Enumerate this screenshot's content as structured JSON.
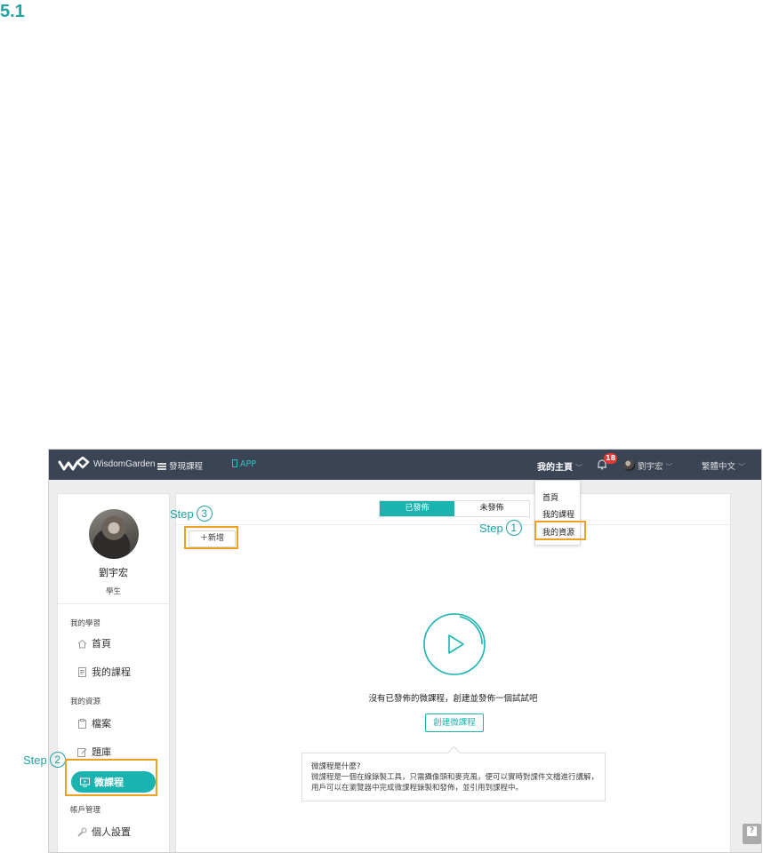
{
  "heading": "5.1",
  "topbar": {
    "brand": "WisdomGarden",
    "discover": "發現課程",
    "app": "APP",
    "home": "我的主頁",
    "notification_count": "18",
    "user": "劉宇宏",
    "language": "繁體中文"
  },
  "dropdown": {
    "items": [
      "首頁",
      "我的課程",
      "我的資源"
    ]
  },
  "sidebar": {
    "name": "劉宇宏",
    "role": "學生",
    "learning_title": "我的學習",
    "learning_items": [
      "首頁",
      "我的課程"
    ],
    "resources_title": "我的資源",
    "resource_items": [
      "檔案",
      "題庫",
      "微課程"
    ],
    "account_title": "帳戶管理",
    "account_items": [
      "個人設置"
    ]
  },
  "main": {
    "tabs": [
      "已發佈",
      "未發佈"
    ],
    "add_button": "＋新增",
    "empty_message": "沒有已發佈的微課程，創建並發佈一個試試吧",
    "create_button": "創建微課程",
    "tip_title": "微課程是什麼?",
    "tip_body": "微課程是一個在線錄製工具，只需攝像頭和麥克風，便可以實時對課件文檔進行講解，用戶可以在瀏覽器中完成微課程錄製和發佈，並引用到課程中。"
  },
  "annotations": {
    "label": "Step",
    "steps": [
      "1",
      "2",
      "3"
    ],
    "highlight_color": "#f0a020",
    "text_color": "#1fa3a5"
  },
  "colors": {
    "accent": "#1ab3b0",
    "topbar": "#3b4454",
    "badge": "#e53935"
  }
}
